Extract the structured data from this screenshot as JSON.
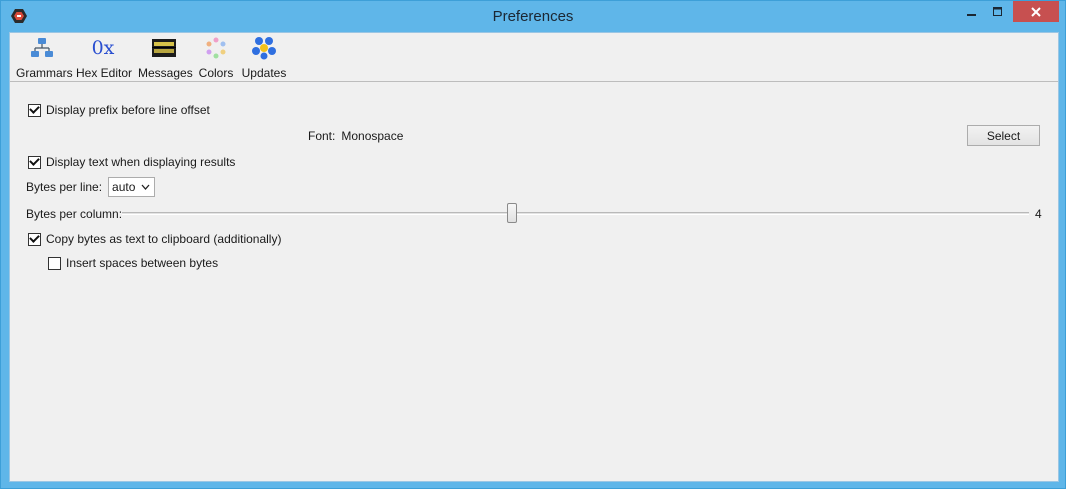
{
  "window": {
    "title": "Preferences"
  },
  "toolbar": {
    "items": [
      {
        "label": "Grammars",
        "icon": "grammars-icon"
      },
      {
        "label": "Hex Editor",
        "icon": "hex-editor-icon",
        "glyph": "0x"
      },
      {
        "label": "Messages",
        "icon": "messages-icon"
      },
      {
        "label": "Colors",
        "icon": "colors-icon"
      },
      {
        "label": "Updates",
        "icon": "updates-icon"
      }
    ]
  },
  "settings": {
    "display_prefix": {
      "label": "Display prefix before line offset",
      "checked": true
    },
    "font": {
      "label": "Font:",
      "value": "Monospace",
      "button": "Select"
    },
    "display_text": {
      "label": "Display text when displaying results",
      "checked": true
    },
    "bytes_per_line": {
      "label": "Bytes per line:",
      "value": "auto"
    },
    "bytes_per_column": {
      "label": "Bytes per column:",
      "value": "4"
    },
    "copy_bytes": {
      "label": "Copy bytes as text to clipboard (additionally)",
      "checked": true
    },
    "insert_spaces": {
      "label": "Insert spaces between bytes",
      "checked": false
    }
  },
  "colors": {
    "titlebar": "#5fb6e9",
    "close_button": "#c75050",
    "client_bg": "#f0f0f0"
  }
}
